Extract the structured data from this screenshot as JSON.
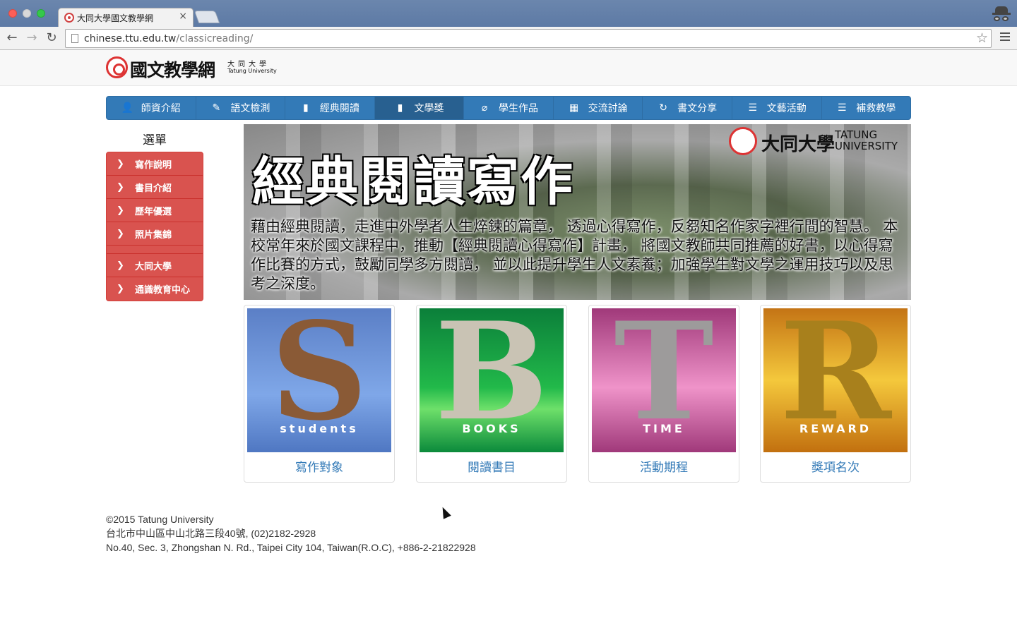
{
  "browser": {
    "tab_title": "大同大學國文教學網",
    "tab_close": "×",
    "url_host": "chinese.ttu.edu.tw",
    "url_path": "/classicreading/",
    "back": "←",
    "forward": "→",
    "reload": "↻",
    "star": "☆"
  },
  "logo": {
    "title": "國文教學網",
    "cn": "大同大學",
    "en": "Tatung University"
  },
  "main_nav": [
    {
      "label": "師資介紹",
      "icon": "user-icon",
      "glyph": "👤"
    },
    {
      "label": "語文檢測",
      "icon": "pencil-icon",
      "glyph": "✎"
    },
    {
      "label": "經典閱讀",
      "icon": "book-icon",
      "glyph": "▮"
    },
    {
      "label": "文學獎",
      "icon": "book-icon",
      "glyph": "▮",
      "active": true
    },
    {
      "label": "學生作品",
      "icon": "paperclip-icon",
      "glyph": "⌀"
    },
    {
      "label": "交流討論",
      "icon": "grid-icon",
      "glyph": "▦"
    },
    {
      "label": "書文分享",
      "icon": "refresh-icon",
      "glyph": "↻"
    },
    {
      "label": "文藝活動",
      "icon": "list-icon",
      "glyph": "☰"
    },
    {
      "label": "補救教學",
      "icon": "list-icon",
      "glyph": "☰"
    }
  ],
  "sidebar": {
    "title": "選單",
    "chevron": "❯",
    "items": [
      {
        "label": "寫作說明"
      },
      {
        "label": "書目介紹"
      },
      {
        "label": "歷年優選"
      },
      {
        "label": "照片集錦"
      }
    ],
    "links": [
      {
        "label": "大同大學"
      },
      {
        "label": "通識教育中心"
      }
    ]
  },
  "banner": {
    "title": "經典閱讀寫作",
    "text": "藉由經典閱讀，走進中外學者人生焠鍊的篇章， 透過心得寫作，反芻知名作家字裡行間的智慧。 本校常年來於國文課程中，推動【經典閱讀心得寫作】計畫， 將國文教師共同推薦的好書，以心得寫作比賽的方式，鼓勵同學多方閱讀， 並以此提升學生人文素養；加強學生對文學之運用技巧以及思考之深度。",
    "logo_cn": "大同大學",
    "logo_en_1": "TATUNG",
    "logo_en_2": "UNIVERSITY"
  },
  "cards": [
    {
      "letter": "S",
      "word": "students",
      "caption": "寫作對象"
    },
    {
      "letter": "B",
      "word": "BOOKS",
      "caption": "閱讀書目"
    },
    {
      "letter": "T",
      "word": "TIME",
      "caption": "活動期程"
    },
    {
      "letter": "R",
      "word": "REWARD",
      "caption": "獎項名次"
    }
  ],
  "footer": {
    "line1": "©2015 Tatung University",
    "line2": "台北市中山區中山北路三段40號, (02)2182-2928",
    "line3": "No.40, Sec. 3, Zhongshan N. Rd., Taipei City 104, Taiwan(R.O.C), +886-2-21822928"
  }
}
